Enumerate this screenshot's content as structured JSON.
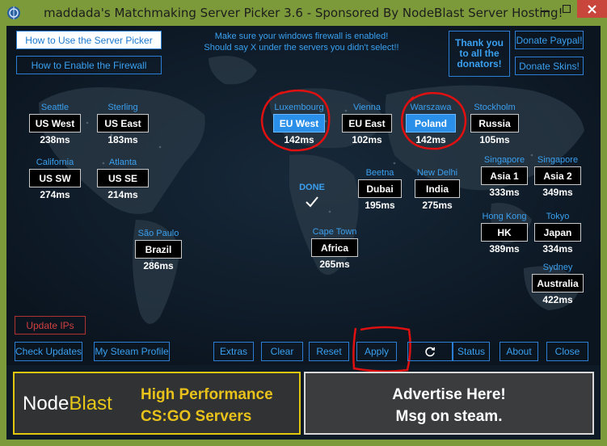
{
  "window": {
    "title": "maddada's Matchmaking Server Picker 3.6 - Sponsored By NodeBlast Server Hosting!"
  },
  "top_buttons": {
    "how_to_use": "How to Use the Server Picker",
    "how_to_firewall": "How to Enable the Firewall",
    "thank_you": "Thank you to all the donators!",
    "donate_paypal": "Donate Paypal!",
    "donate_skins": "Donate Skins!"
  },
  "notice": {
    "line1": "Make sure your windows firewall is enabled!",
    "line2": "Should say X under the servers you didn't select!!"
  },
  "servers": [
    {
      "id": "seattle",
      "city": "Seattle",
      "label": "US West",
      "ping": "238ms",
      "selected": false
    },
    {
      "id": "sterling",
      "city": "Sterling",
      "label": "US East",
      "ping": "183ms",
      "selected": false
    },
    {
      "id": "california",
      "city": "California",
      "label": "US SW",
      "ping": "274ms",
      "selected": false
    },
    {
      "id": "atlanta",
      "city": "Atlanta",
      "label": "US SE",
      "ping": "214ms",
      "selected": false
    },
    {
      "id": "saopaulo",
      "city": "São Paulo",
      "label": "Brazil",
      "ping": "286ms",
      "selected": false
    },
    {
      "id": "luxembourg",
      "city": "Luxembourg",
      "label": "EU West",
      "ping": "142ms",
      "selected": true
    },
    {
      "id": "vienna",
      "city": "Vienna",
      "label": "EU East",
      "ping": "102ms",
      "selected": false
    },
    {
      "id": "warszawa",
      "city": "Warszawa",
      "label": "Poland",
      "ping": "142ms",
      "selected": true
    },
    {
      "id": "stockholm",
      "city": "Stockholm",
      "label": "Russia",
      "ping": "105ms",
      "selected": false
    },
    {
      "id": "beetna",
      "city": "Beetna",
      "label": "Dubai",
      "ping": "195ms",
      "selected": false
    },
    {
      "id": "newdelhi",
      "city": "New Delhi",
      "label": "India",
      "ping": "275ms",
      "selected": false
    },
    {
      "id": "singapore1",
      "city": "Singapore",
      "label": "Asia 1",
      "ping": "333ms",
      "selected": false
    },
    {
      "id": "singapore2",
      "city": "Singapore",
      "label": "Asia 2",
      "ping": "349ms",
      "selected": false
    },
    {
      "id": "hongkong",
      "city": "Hong Kong",
      "label": "HK",
      "ping": "389ms",
      "selected": false
    },
    {
      "id": "tokyo",
      "city": "Tokyo",
      "label": "Japan",
      "ping": "334ms",
      "selected": false
    },
    {
      "id": "capetown",
      "city": "Cape Town",
      "label": "Africa",
      "ping": "265ms",
      "selected": false
    },
    {
      "id": "sydney",
      "city": "Sydney",
      "label": "Australia",
      "ping": "422ms",
      "selected": false
    }
  ],
  "status": {
    "done": "DONE",
    "check_icon": "checkmark-icon"
  },
  "bottom_buttons": {
    "update_ips": "Update IPs",
    "check_updates": "Check Updates",
    "steam_profile": "My Steam Profile",
    "extras": "Extras",
    "clear": "Clear",
    "reset": "Reset",
    "apply": "Apply",
    "refresh_icon": "refresh-icon",
    "status": "Status",
    "about": "About",
    "close": "Close"
  },
  "ads": {
    "left": {
      "logo_part1": "Node",
      "logo_part2": "Blast",
      "line1": "High Performance",
      "line2": "CS:GO Servers"
    },
    "right": {
      "line1": "Advertise Here!",
      "line2": "Msg on steam."
    }
  },
  "colors": {
    "accent": "#3aa0f0",
    "selected": "#2a8fe8",
    "annotation": "#e01010",
    "ad_gold": "#e8c21b"
  }
}
